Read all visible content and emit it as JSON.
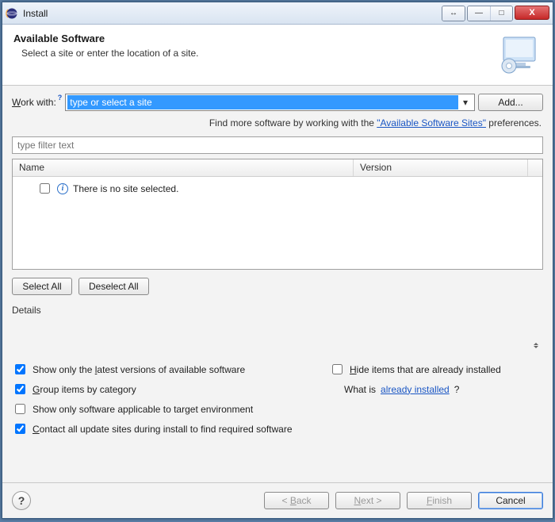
{
  "window": {
    "title": "Install"
  },
  "header": {
    "title": "Available Software",
    "subtitle": "Select a site or enter the location of a site."
  },
  "workwith": {
    "label_pre": "",
    "label": "Work with:",
    "label_accel": "W",
    "superscript": "?",
    "combo_value": "type or select a site",
    "add_label": "Add..."
  },
  "hint": {
    "prefix": "Find more software by working with the ",
    "link": "\"Available Software Sites\"",
    "suffix": " preferences."
  },
  "filter": {
    "placeholder": "type filter text"
  },
  "tree": {
    "columns": {
      "name": "Name",
      "version": "Version"
    },
    "empty_message": "There is no site selected."
  },
  "selection_buttons": {
    "select_all": "Select All",
    "deselect_all": "Deselect All"
  },
  "details": {
    "label": "Details"
  },
  "options": [
    {
      "key": "latest",
      "checked": true,
      "text": "Show only the latest versions of available software",
      "accel": "l"
    },
    {
      "key": "hide_installed",
      "checked": false,
      "text": "Hide items that are already installed",
      "accel": "H"
    },
    {
      "key": "group_category",
      "checked": true,
      "text": "Group items by category",
      "accel": "G"
    },
    {
      "key": "whatis",
      "checked": null,
      "text_prefix": "What is ",
      "link": "already installed",
      "text_suffix": "?"
    },
    {
      "key": "target_env",
      "checked": false,
      "text": "Show only software applicable to target environment"
    },
    {
      "key": "contact_sites",
      "checked": true,
      "text": "Contact all update sites during install to find required software",
      "accel": "C"
    }
  ],
  "footer": {
    "help_label": "?",
    "back": "< Back",
    "next": "Next >",
    "finish": "Finish",
    "cancel": "Cancel"
  },
  "titlebar_buttons": {
    "move": "↔",
    "minimize": "—",
    "maximize": "□",
    "close": "X"
  }
}
